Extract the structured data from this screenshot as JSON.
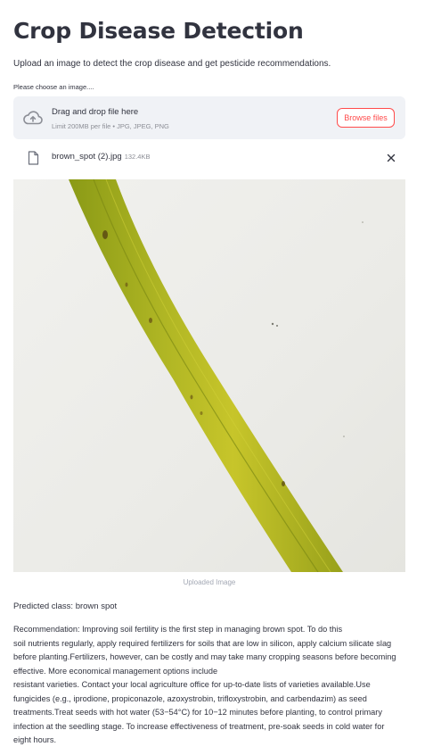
{
  "header": {
    "title": "Crop Disease Detection",
    "subtitle": "Upload an image to detect the crop disease and get pesticide recommendations."
  },
  "uploader": {
    "label": "Please choose an image....",
    "drop_text": "Drag and drop file here",
    "limit_text": "Limit 200MB per file • JPG, JPEG, PNG",
    "browse_label": "Browse files",
    "icon": "cloud-upload-icon"
  },
  "uploaded_file": {
    "name": "brown_spot (2).jpg",
    "size": "132.4KB",
    "icon": "file-icon"
  },
  "image": {
    "caption": "Uploaded Image"
  },
  "result": {
    "prediction": "Predicted class: brown spot",
    "recommendation_lines": [
      "Recommendation: Improving soil fertility is the first step in managing brown spot. To do this",
      "soil nutrients regularly, apply required fertilizers for soils that are low in silicon, apply calcium silicate slag",
      "before planting.Fertilizers, however, can be costly and may take many cropping seasons before becoming",
      "effective. More economical management options include",
      "resistant varieties. Contact your local agriculture office for up-to-date lists of varieties available.Use",
      "fungicides (e.g., iprodione, propiconazole, azoxystrobin, trifloxystrobin, and carbendazim) as seed",
      "treatments.Treat seeds with hot water (53−54°C) for 10−12 minutes before planting, to control primary",
      "infection at the seedling stage. To increase effectiveness of treatment, pre-soak seeds in cold water for",
      "eight hours."
    ]
  },
  "colors": {
    "accent": "#ff4b4b",
    "text": "#31333f",
    "dropzone_bg": "#f0f2f6",
    "muted": "#8c8e96"
  }
}
